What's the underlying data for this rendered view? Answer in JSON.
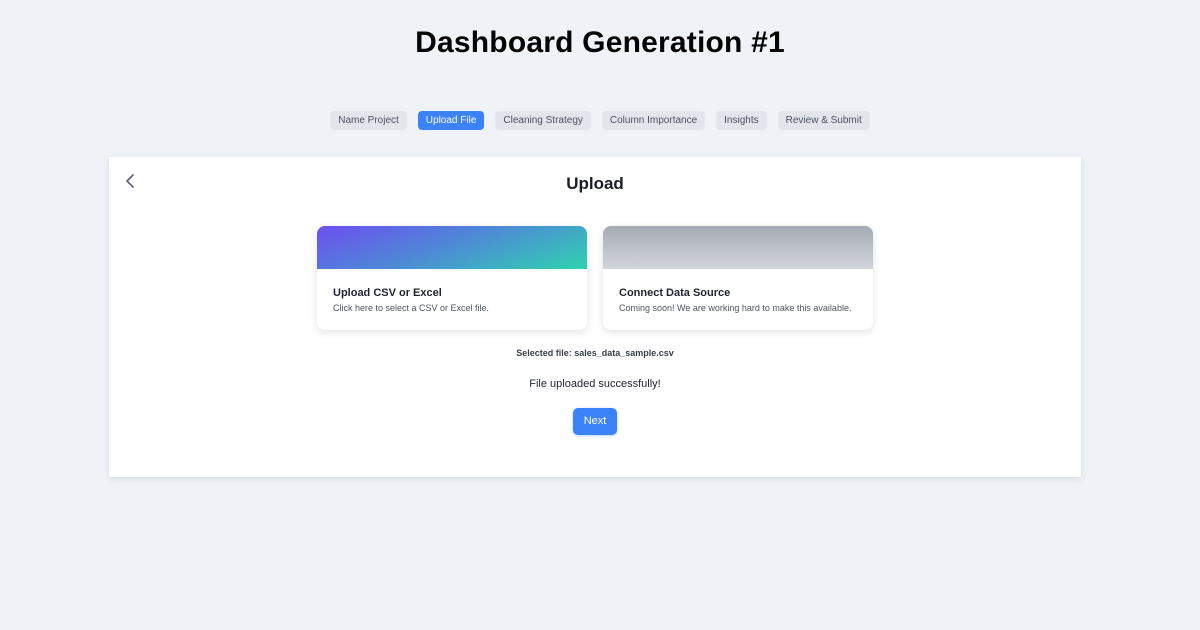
{
  "page": {
    "title": "Dashboard Generation #1"
  },
  "stepper": {
    "steps": [
      {
        "label": "Name Project",
        "active": false
      },
      {
        "label": "Upload File",
        "active": true
      },
      {
        "label": "Cleaning Strategy",
        "active": false
      },
      {
        "label": "Column Importance",
        "active": false
      },
      {
        "label": "Insights",
        "active": false
      },
      {
        "label": "Review & Submit",
        "active": false
      }
    ]
  },
  "panel": {
    "back_icon": "chevron-left-icon",
    "title": "Upload",
    "cards": {
      "upload": {
        "title": "Upload CSV or Excel",
        "description": "Click here to select a CSV or Excel file."
      },
      "connect": {
        "title": "Connect Data Source",
        "description": "Coming soon! We are working hard to make this available."
      }
    },
    "selected_file": "Selected file: sales_data_sample.csv",
    "status": "File uploaded successfully!",
    "next_label": "Next"
  },
  "colors": {
    "accent": "#3b82f6",
    "background": "#eff3f8",
    "step_inactive": "#e2e6ec"
  }
}
